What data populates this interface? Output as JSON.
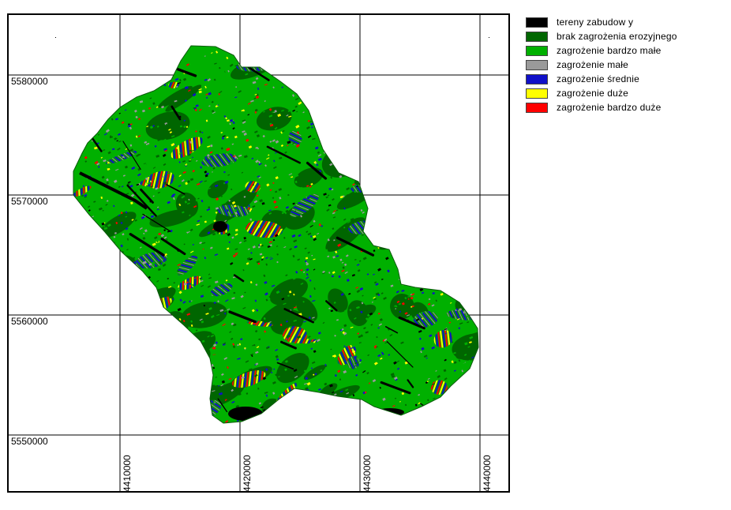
{
  "map": {
    "y_ticks": [
      {
        "label": "5580000",
        "value": 5580000
      },
      {
        "label": "5570000",
        "value": 5570000
      },
      {
        "label": "5560000",
        "value": 5560000
      },
      {
        "label": "5550000",
        "value": 5550000
      }
    ],
    "x_ticks": [
      {
        "label": "4410000",
        "value": 4410000
      },
      {
        "label": "4420000",
        "value": 4420000
      },
      {
        "label": "4430000",
        "value": 4430000
      },
      {
        "label": "4440000",
        "value": 4440000
      }
    ]
  },
  "legend": {
    "items": [
      {
        "label": "tereny zabudow y",
        "color": "#000000"
      },
      {
        "label": "brak zagrożenia erozyjnego",
        "color": "#006600"
      },
      {
        "label": "zagrożenie bardzo małe",
        "color": "#00b000"
      },
      {
        "label": "zagrożenie małe",
        "color": "#9a9a9a"
      },
      {
        "label": "zagrożenie średnie",
        "color": "#1010c8"
      },
      {
        "label": "zagrożenie duże",
        "color": "#ffff00"
      },
      {
        "label": "zagrożenie bardzo duże",
        "color": "#ff0000"
      }
    ]
  }
}
